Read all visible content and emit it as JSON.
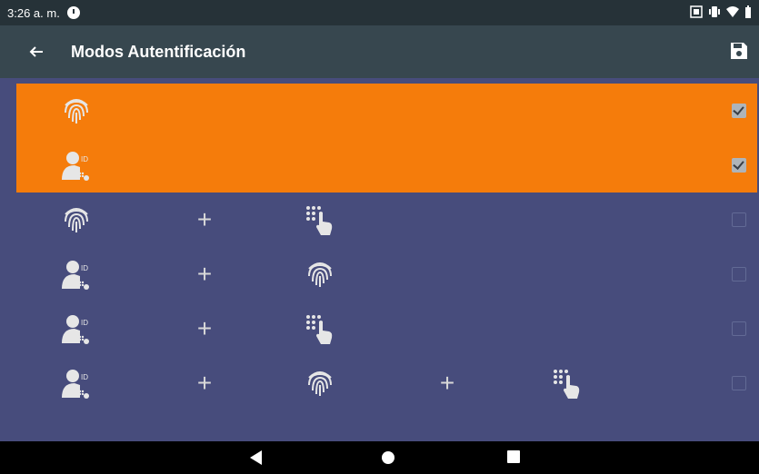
{
  "status": {
    "time": "3:26 a. m."
  },
  "appbar": {
    "title": "Modos Autentificación"
  },
  "colors": {
    "selected_row": "#f57c0b",
    "list_bg": "#474c7c",
    "appbar_bg": "#37474f"
  },
  "rows": [
    {
      "checked": true,
      "icons": [
        "fingerprint-icon"
      ]
    },
    {
      "checked": true,
      "icons": [
        "user-id-icon"
      ]
    },
    {
      "checked": false,
      "icons": [
        "fingerprint-icon",
        "plus",
        "keypad-touch-icon"
      ]
    },
    {
      "checked": false,
      "icons": [
        "user-id-icon",
        "plus",
        "fingerprint-icon"
      ]
    },
    {
      "checked": false,
      "icons": [
        "user-id-icon",
        "plus",
        "keypad-touch-icon"
      ]
    },
    {
      "checked": false,
      "icons": [
        "user-id-icon",
        "plus",
        "fingerprint-icon",
        "plus",
        "keypad-touch-icon"
      ]
    }
  ],
  "labels": {
    "id_badge": "ID",
    "plus": "+"
  }
}
